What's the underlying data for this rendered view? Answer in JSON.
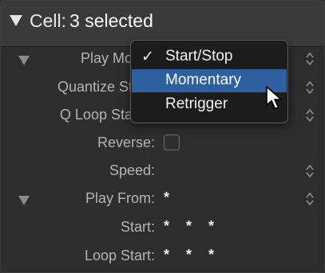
{
  "header": {
    "label": "Cell:",
    "value": "3 selected"
  },
  "rows": {
    "play_mode": {
      "label": "Play Mo"
    },
    "quantize_start": {
      "label": "Quantize St"
    },
    "q_loop_start": {
      "label": "Q Loop Sta"
    },
    "reverse": {
      "label": "Reverse:"
    },
    "speed": {
      "label": "Speed:",
      "value": ""
    },
    "play_from": {
      "label": "Play From:",
      "value": "*"
    },
    "start": {
      "label": "Start:",
      "value": "* * *"
    },
    "loop_start": {
      "label": "Loop Start:",
      "value": "* * *"
    }
  },
  "menu": {
    "items": [
      {
        "label": "Start/Stop",
        "checked": true,
        "check_mark": "✓"
      },
      {
        "label": "Momentary",
        "checked": false,
        "highlighted": true
      },
      {
        "label": "Retrigger",
        "checked": false
      }
    ]
  },
  "colors": {
    "highlight": "#2e5fa0",
    "panel_bg": "#2d2d2d",
    "header_bg": "#3a3a3a"
  }
}
